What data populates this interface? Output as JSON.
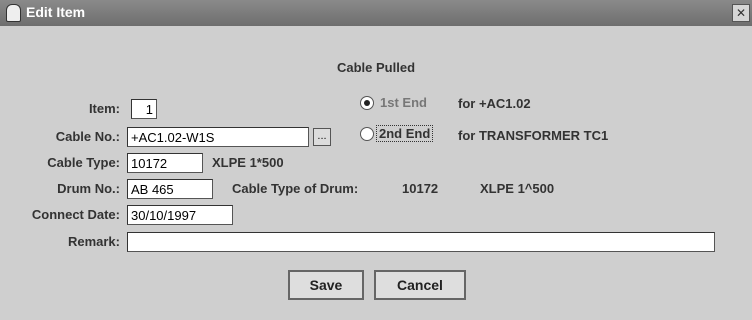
{
  "window": {
    "title": "Edit Item",
    "close_glyph": "✕"
  },
  "form": {
    "heading": "Cable Pulled",
    "item": {
      "label": "Item:",
      "value": "1"
    },
    "cable_no": {
      "label": "Cable No.:",
      "value": "+AC1.02-W1S",
      "browse_label": "..."
    },
    "cable_type": {
      "label": "Cable Type:",
      "value": "10172",
      "description": "XLPE 1*500"
    },
    "drum_no": {
      "label": "Drum No.:",
      "value": "AB 465",
      "drum_type_label": "Cable Type of Drum:",
      "drum_type_value": "10172",
      "drum_type_desc": "XLPE 1^500"
    },
    "connect_date": {
      "label": "Connect Date:",
      "value": "30/10/1997"
    },
    "remark": {
      "label": "Remark:",
      "value": ""
    },
    "ends": {
      "first": {
        "label": "1st End",
        "for_text": "for +AC1.02",
        "selected": true
      },
      "second": {
        "label": "2nd End",
        "for_text": "for TRANSFORMER TC1",
        "selected": false
      }
    }
  },
  "buttons": {
    "save": "Save",
    "cancel": "Cancel"
  },
  "colors": {
    "titlebar": "#7a7a7a",
    "panel": "#cfcfcf",
    "field_bg": "#ffffff"
  }
}
